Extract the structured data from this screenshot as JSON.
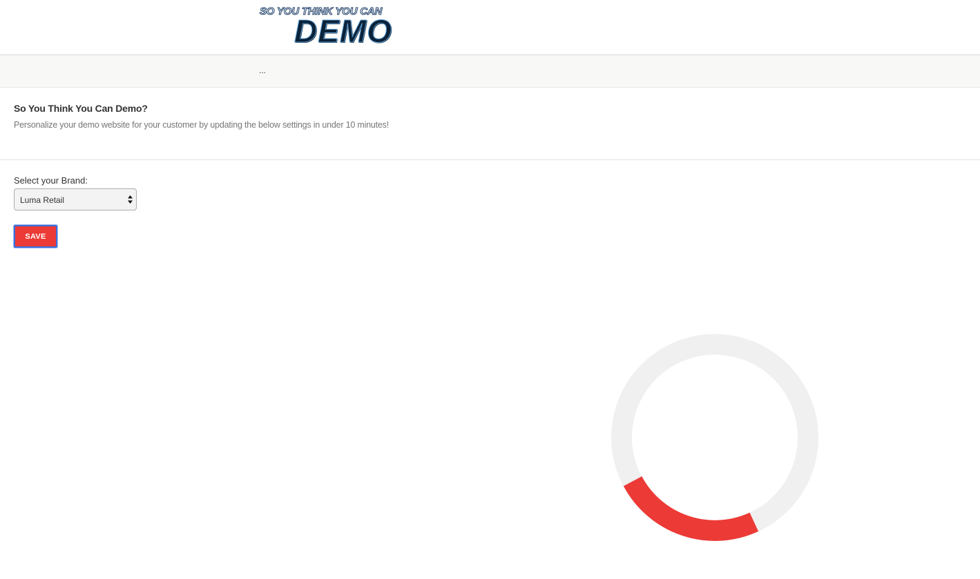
{
  "header": {
    "logo_line1": "SO YOU THINK YOU CAN",
    "logo_line2": "DEMO"
  },
  "breadcrumb": {
    "text": "..."
  },
  "intro": {
    "title": "So You Think You Can Demo?",
    "subtitle": "Personalize your demo website for your customer by updating the below settings in under 10 minutes!"
  },
  "form": {
    "brand_label": "Select your Brand:",
    "brand_selected": "Luma Retail",
    "save_label": "SAVE"
  },
  "colors": {
    "accent": "#ec3a36",
    "spinner_track": "#f0f0f0",
    "spinner_arc": "#ec3a36",
    "focus_ring": "#3b6fdb"
  },
  "icons": {
    "select_arrows": "up-down-arrows-icon",
    "loading": "loading-spinner-icon"
  }
}
